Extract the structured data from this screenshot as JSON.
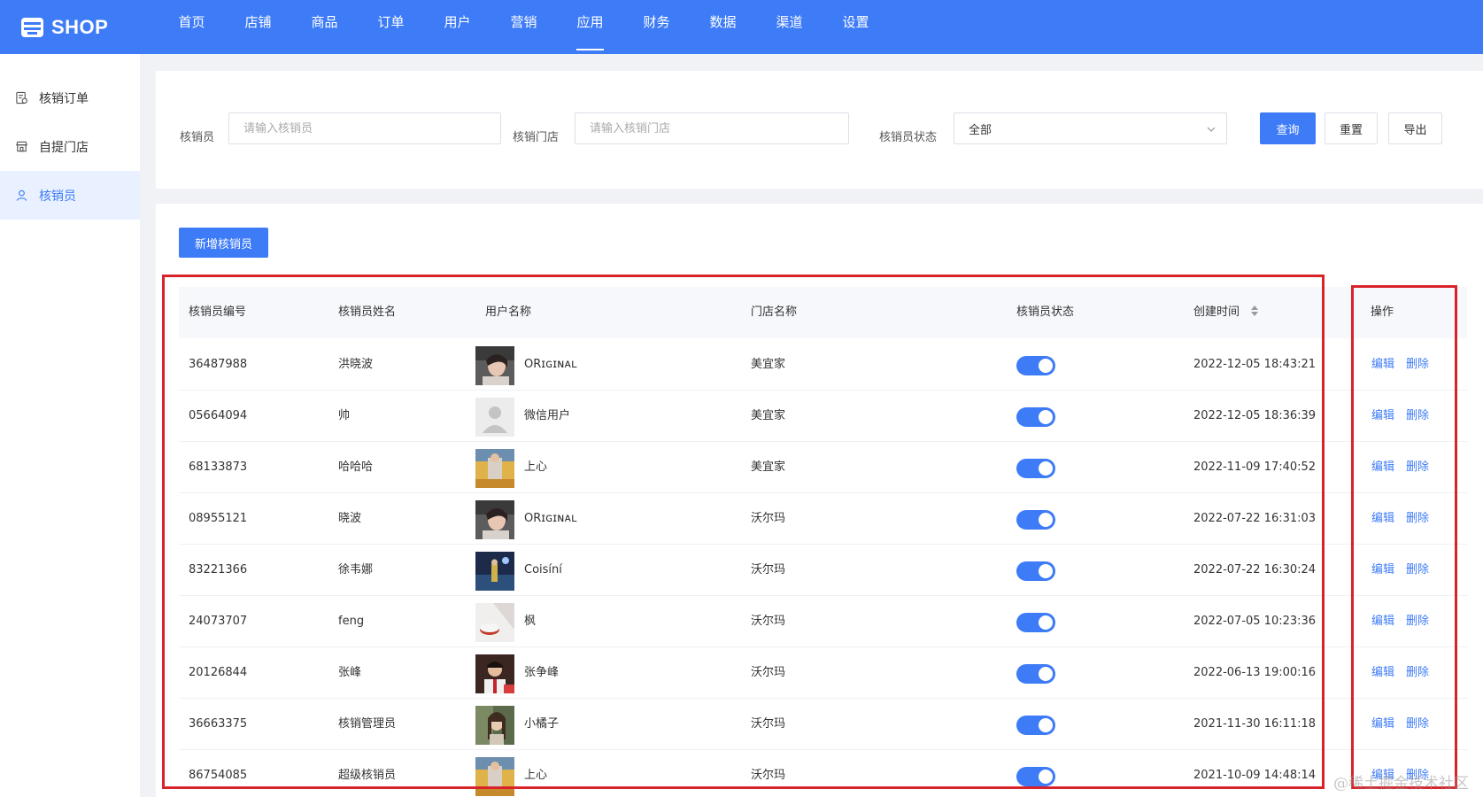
{
  "brand": {
    "name": "SHOP"
  },
  "topnav": {
    "items": [
      "首页",
      "店铺",
      "商品",
      "订单",
      "用户",
      "营销",
      "应用",
      "财务",
      "数据",
      "渠道",
      "设置"
    ],
    "active": "应用"
  },
  "sidebar": {
    "items": [
      {
        "label": "核销订单",
        "icon": "order-check-icon",
        "active": false
      },
      {
        "label": "自提门店",
        "icon": "store-icon",
        "active": false
      },
      {
        "label": "核销员",
        "icon": "user-icon",
        "active": true
      }
    ]
  },
  "filters": {
    "verifier_label": "核销员",
    "verifier_placeholder": "请输入核销员",
    "store_label": "核销门店",
    "store_placeholder": "请输入核销门店",
    "status_label": "核销员状态",
    "status_value": "全部",
    "query_button": "查询",
    "reset_button": "重置",
    "export_button": "导出"
  },
  "list": {
    "add_button": "新增核销员",
    "columns": [
      "核销员编号",
      "核销员姓名",
      "用户名称",
      "门店名称",
      "核销员状态",
      "创建时间",
      "操作"
    ],
    "edit_label": "编辑",
    "delete_label": "删除",
    "rows": [
      {
        "id": "36487988",
        "name": "洪晓波",
        "user": "ORɪɢɪɴᴀʟ",
        "store": "美宜家",
        "enabled": true,
        "created": "2022-12-05 18:43:21"
      },
      {
        "id": "05664094",
        "name": "帅",
        "user": "微信用户",
        "store": "美宜家",
        "enabled": true,
        "created": "2022-12-05 18:36:39"
      },
      {
        "id": "68133873",
        "name": "哈哈哈",
        "user": "上心",
        "store": "美宜家",
        "enabled": true,
        "created": "2022-11-09 17:40:52"
      },
      {
        "id": "08955121",
        "name": "晓波",
        "user": "ORɪɢɪɴᴀʟ",
        "store": "沃尔玛",
        "enabled": true,
        "created": "2022-07-22 16:31:03"
      },
      {
        "id": "83221366",
        "name": "徐韦娜",
        "user": "Coisíní",
        "store": "沃尔玛",
        "enabled": true,
        "created": "2022-07-22 16:30:24"
      },
      {
        "id": "24073707",
        "name": "feng",
        "user": "枫",
        "store": "沃尔玛",
        "enabled": true,
        "created": "2022-07-05 10:23:36"
      },
      {
        "id": "20126844",
        "name": "张峰",
        "user": "张争峰",
        "store": "沃尔玛",
        "enabled": true,
        "created": "2022-06-13 19:00:16"
      },
      {
        "id": "36663375",
        "name": "核销管理员",
        "user": "小橘子",
        "store": "沃尔玛",
        "enabled": true,
        "created": "2021-11-30 16:11:18"
      },
      {
        "id": "86754085",
        "name": "超级核销员",
        "user": "上心",
        "store": "沃尔玛",
        "enabled": true,
        "created": "2021-10-09 14:48:14"
      }
    ]
  },
  "watermark": "@稀土掘金技术社区",
  "colors": {
    "primary": "#3d7bf7",
    "highlight": "#d9232b"
  }
}
